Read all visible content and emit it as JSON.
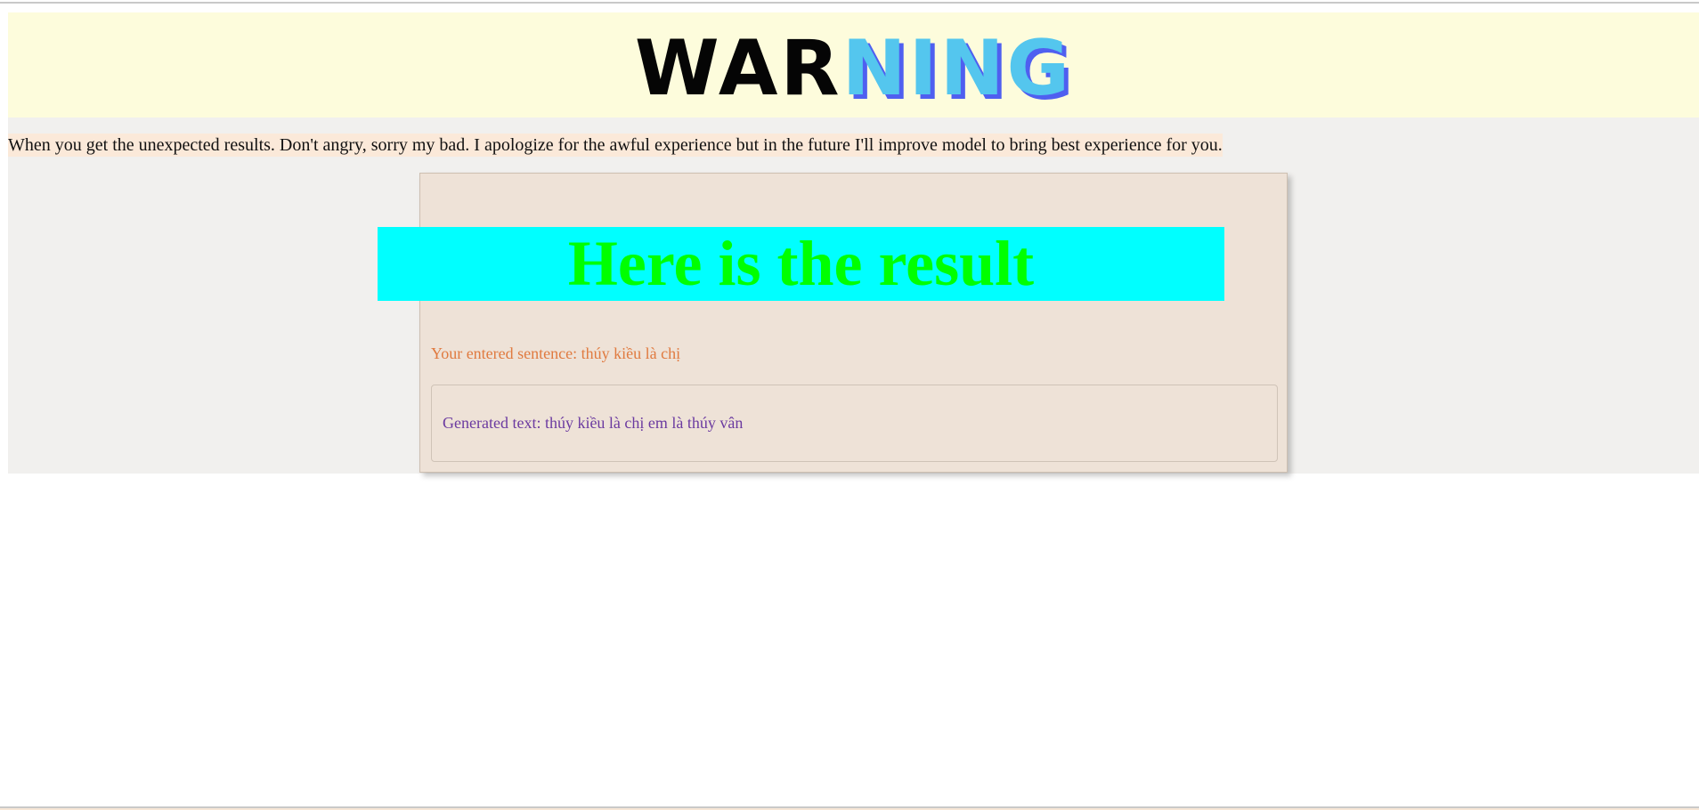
{
  "banner": {
    "title_dark": "WAR",
    "title_blue": "NING"
  },
  "notice": {
    "apology_text": "When you get the unexpected results. Don't angry, sorry my bad. I apologize for the awful experience but in the future I'll improve model to bring best experience for you."
  },
  "result": {
    "heading": "Here is the result",
    "entered_label": "Your entered sentence: thúy kiều là chị",
    "generated_label": "Generated text: thúy kiều là chị em là thúy vân"
  },
  "colors": {
    "banner_background": "#fdfcdc",
    "title_dark": "#050505",
    "title_blue": "#54c6ee",
    "title_shadow": "#4f5ff0",
    "heading_background": "#00ffff",
    "heading_text": "#00ff00",
    "entered_text": "#e07a3f",
    "generated_text": "#6b3aa0",
    "card_background": "#eee2d7"
  }
}
